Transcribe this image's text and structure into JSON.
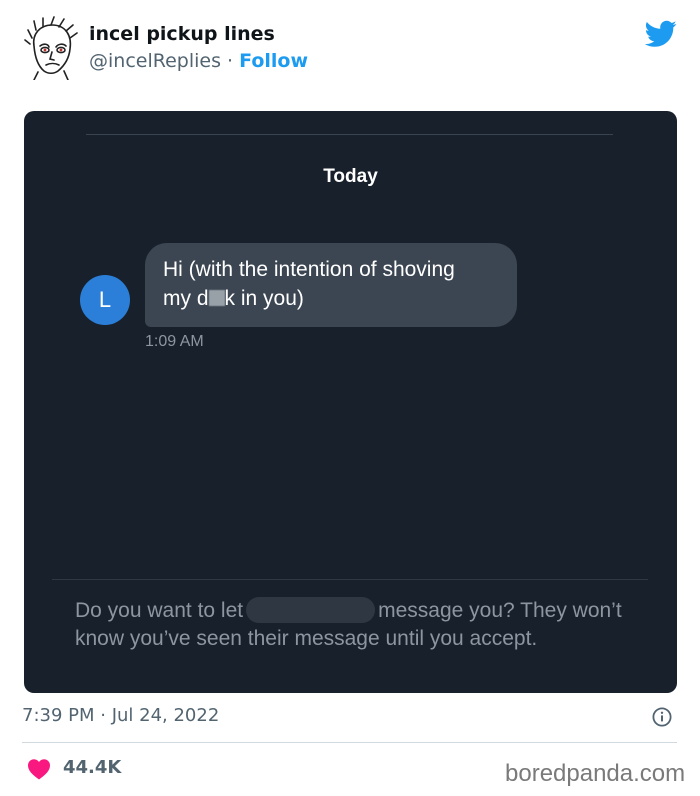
{
  "header": {
    "display_name": "incel pickup lines",
    "handle": "@incelReplies",
    "separator": " · ",
    "follow_label": "Follow",
    "avatar_icon": "wojak-sketch-avatar",
    "brand_icon": "twitter-bird-icon",
    "brand_color": "#1d9bf0"
  },
  "screenshot": {
    "date_header": "Today",
    "sender_initial": "L",
    "message_line1": "Hi (with the intention of shoving",
    "message_line2_start": "my d",
    "message_line2_end": "k in you)",
    "message_time": "1:09 AM",
    "prompt_start": "Do you want to let",
    "prompt_end": "message you? They won’t know you’ve seen their message until you accept."
  },
  "footer": {
    "timestamp": "7:39 PM · Jul 24, 2022",
    "likes": "44.4K",
    "like_color": "#f91880",
    "watermark": "boredpanda.com"
  }
}
